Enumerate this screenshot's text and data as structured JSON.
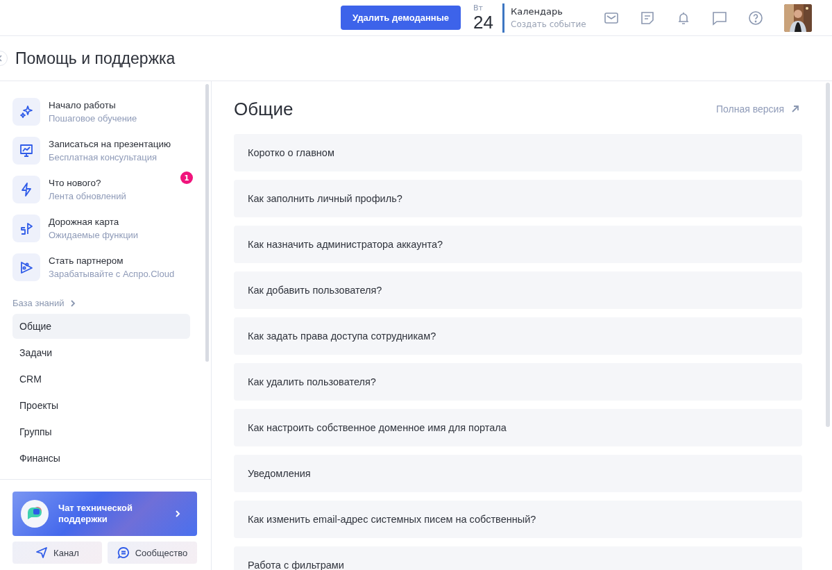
{
  "header": {
    "demo_button": "Удалить демоданные",
    "date": {
      "weekday": "Вт",
      "day": "24"
    },
    "calendar": {
      "title": "Календарь",
      "action": "Создать событие"
    },
    "icons": [
      {
        "kind": "mail"
      },
      {
        "kind": "notes"
      },
      {
        "kind": "bell"
      },
      {
        "kind": "chat"
      },
      {
        "kind": "help"
      }
    ]
  },
  "page": {
    "title": "Помощь и поддержка"
  },
  "sidebar": {
    "links": [
      {
        "kind": "sparkle",
        "title": "Начало работы",
        "subtitle": "Пошаговое обучение"
      },
      {
        "kind": "presentation",
        "title": "Записаться на презентацию",
        "subtitle": "Бесплатная консультация"
      },
      {
        "kind": "bolt",
        "title": "Что нового?",
        "subtitle": "Лента обновлений",
        "badge": "1"
      },
      {
        "kind": "flag",
        "title": "Дорожная карта",
        "subtitle": "Ожидаемые функции"
      },
      {
        "kind": "partner",
        "title": "Стать партнером",
        "subtitle": "Зарабатывайте с Аспро.Cloud"
      }
    ],
    "knowledge_base": {
      "heading": "База знаний",
      "items": [
        {
          "label": "Общие",
          "selected": true
        },
        {
          "label": "Задачи",
          "selected": false
        },
        {
          "label": "CRM",
          "selected": false
        },
        {
          "label": "Проекты",
          "selected": false
        },
        {
          "label": "Группы",
          "selected": false
        },
        {
          "label": "Финансы",
          "selected": false
        }
      ]
    },
    "support_chat": "Чат технической поддержки",
    "buttons": [
      {
        "kind": "channel",
        "label": "Канал"
      },
      {
        "kind": "community",
        "label": "Сообщество"
      }
    ]
  },
  "content": {
    "title": "Общие",
    "full_version": "Полная версия",
    "articles": [
      "Коротко о главном",
      "Как заполнить личный профиль?",
      "Как назначить администратора аккаунта?",
      "Как добавить пользователя?",
      "Как задать права доступа сотрудникам?",
      "Как удалить пользователя?",
      "Как настроить собственное доменное имя для портала",
      "Уведомления",
      "Как изменить email-адрес системных писем на собственный?",
      "Работа с фильтрами"
    ]
  }
}
